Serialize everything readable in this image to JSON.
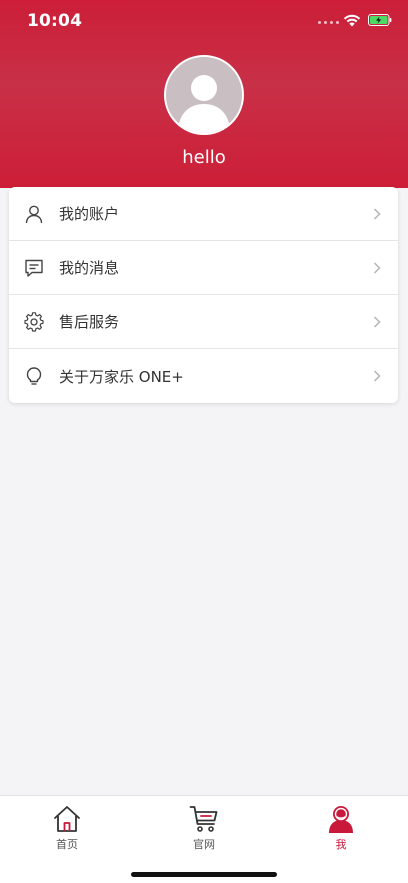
{
  "status_bar": {
    "time": "10:04"
  },
  "profile": {
    "username": "hello"
  },
  "menu": {
    "items": [
      {
        "label": "我的账户",
        "icon": "user-icon"
      },
      {
        "label": "我的消息",
        "icon": "message-icon"
      },
      {
        "label": "售后服务",
        "icon": "gear-icon"
      },
      {
        "label": "关于万家乐 ONE+",
        "icon": "lightbulb-icon"
      }
    ]
  },
  "tab_bar": {
    "tabs": [
      {
        "label": "首页",
        "icon": "home-icon"
      },
      {
        "label": "官网",
        "icon": "cart-icon"
      },
      {
        "label": "我",
        "icon": "profile-icon",
        "active": true
      }
    ]
  },
  "colors": {
    "brand_red": "#c8193a",
    "header_red": "#cc1e38",
    "background": "#f4f4f6"
  }
}
